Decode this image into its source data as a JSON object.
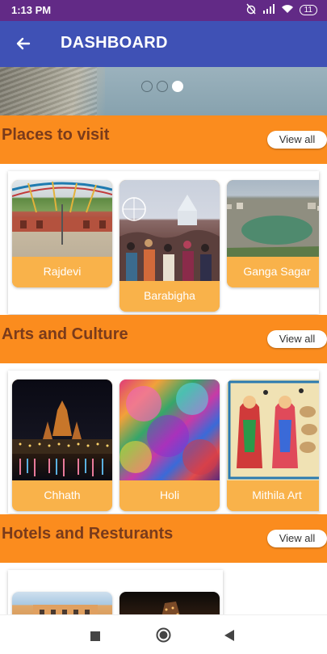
{
  "status": {
    "time": "1:13 PM",
    "battery": "11"
  },
  "appbar": {
    "title": "DASHBOARD"
  },
  "banner": {
    "dots": 3,
    "active_dot": 3
  },
  "sections": [
    {
      "title": "Places to visit",
      "view_all": "View all",
      "cards": [
        {
          "label": "Rajdevi"
        },
        {
          "label": "Barabigha"
        },
        {
          "label": "Ganga Sagar"
        }
      ]
    },
    {
      "title": "Arts and Culture",
      "view_all": "View all",
      "cards": [
        {
          "label": "Chhath"
        },
        {
          "label": "Holi"
        },
        {
          "label": "Mithila Art"
        }
      ]
    },
    {
      "title": "Hotels and Resturants",
      "view_all": "View all",
      "cards": []
    }
  ],
  "colors": {
    "status_bar": "#622a86",
    "app_bar": "#3f51b5",
    "section_bg": "#fb8c1e",
    "section_title": "#7a3b1b",
    "card_label_bg": "#f9b24a"
  }
}
